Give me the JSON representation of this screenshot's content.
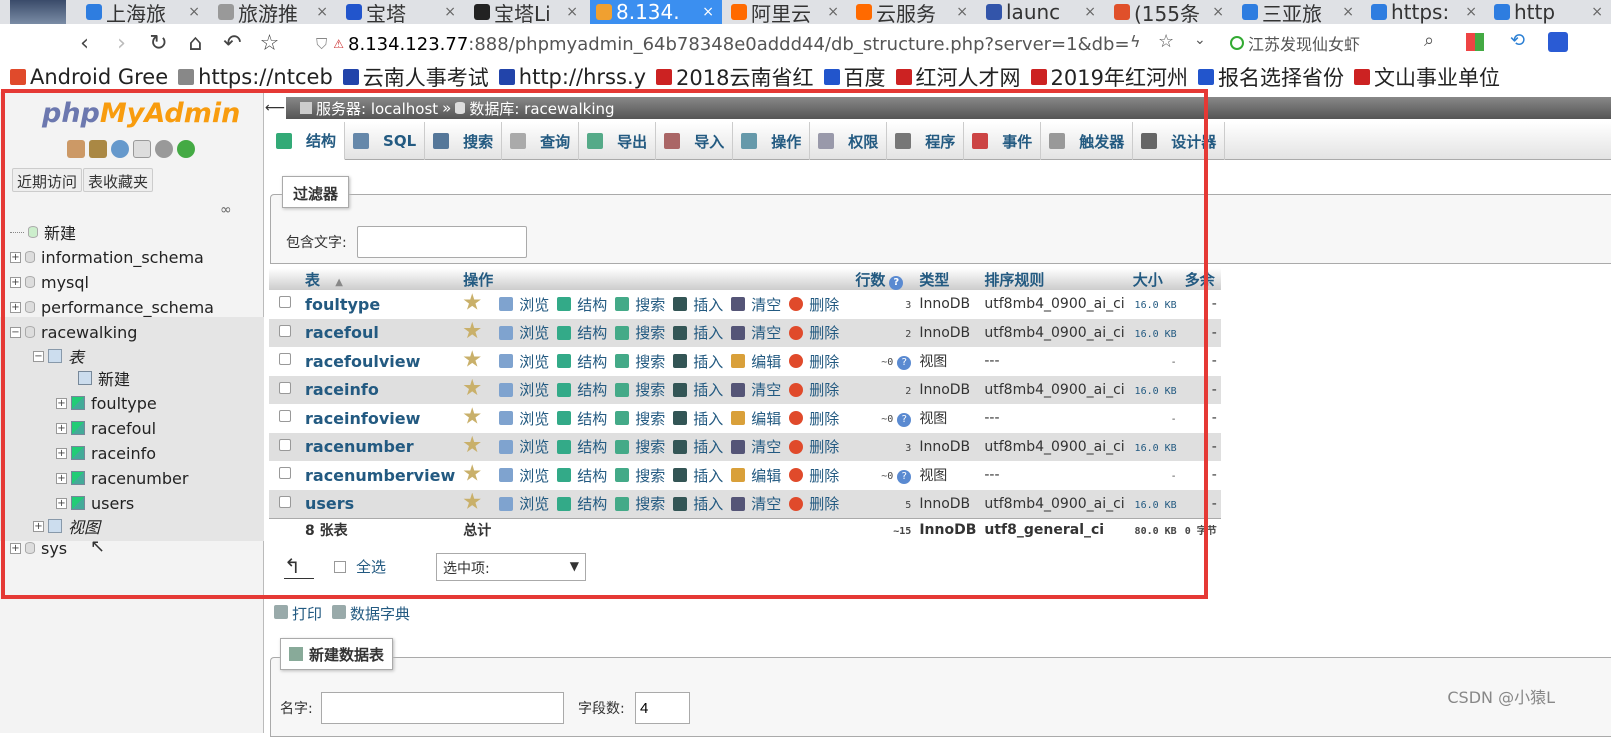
{
  "browser": {
    "tabs": [
      {
        "title": "上海旅",
        "color": "#2e7de0",
        "icon": "c"
      },
      {
        "title": "旅游推",
        "color": "#999999",
        "icon": "doc"
      },
      {
        "title": "宝塔_",
        "color": "#2255cc",
        "icon": "paw"
      },
      {
        "title": "宝塔Li",
        "color": "#222222",
        "icon": "BT"
      },
      {
        "title": "8.134.",
        "color": "#f0a030",
        "icon": "pma",
        "active": true
      },
      {
        "title": "阿里云",
        "color": "#ff6a00",
        "icon": "ali"
      },
      {
        "title": "云服务",
        "color": "#ff6a00",
        "icon": "ali"
      },
      {
        "title": "launc",
        "color": "#3355aa",
        "icon": "launch"
      },
      {
        "title": "(155条",
        "color": "#e0502a",
        "icon": "C"
      },
      {
        "title": "三亚旅",
        "color": "#2e7de0",
        "icon": "c"
      },
      {
        "title": "https:",
        "color": "#2e7de0",
        "icon": "c"
      },
      {
        "title": "http",
        "color": "#2e7de0",
        "icon": "c"
      }
    ],
    "close_glyph": "×",
    "url_prefix": "8.134.123.77",
    "url_rest": ":888/phpmyadmin_64b78348e0addd44/db_structure.php?server=1&db=",
    "search_hint": "江苏发现仙女虾",
    "bookmarks": [
      {
        "label": "Android Gree",
        "color": "#e04a2b"
      },
      {
        "label": "https://ntceb",
        "color": "#888888"
      },
      {
        "label": "云南人事考试",
        "color": "#2244aa"
      },
      {
        "label": "http://hrss.y",
        "color": "#2244aa"
      },
      {
        "label": "2018云南省红",
        "color": "#cc2222"
      },
      {
        "label": "百度",
        "color": "#2255cc"
      },
      {
        "label": "红河人才网",
        "color": "#cc2222"
      },
      {
        "label": "2019年红河州",
        "color": "#cc2222"
      },
      {
        "label": "报名选择省份",
        "color": "#2255cc"
      },
      {
        "label": "文山事业单位",
        "color": "#cc2222"
      }
    ]
  },
  "sidebar": {
    "logo_a": "php",
    "logo_b": "MyAdmin",
    "btn_recent": "近期访问",
    "btn_fav": "表收藏夹",
    "link_glyph": "∞",
    "tree": {
      "new": "新建",
      "dbs": [
        "information_schema",
        "mysql",
        "performance_schema",
        "racewalking",
        "sys"
      ],
      "tables_group": "表",
      "tables_new": "新建",
      "tables": [
        "foultype",
        "racefoul",
        "raceinfo",
        "racenumber",
        "users"
      ],
      "views_group": "视图"
    }
  },
  "main": {
    "breadcrumb_server": "服务器: localhost",
    "breadcrumb_sep": "»",
    "breadcrumb_db": "数据库: racewalking",
    "menu": [
      {
        "label": "结构",
        "color": "#3a7"
      },
      {
        "label": "SQL",
        "color": "#68a"
      },
      {
        "label": "搜索",
        "color": "#579"
      },
      {
        "label": "查询",
        "color": "#aaa"
      },
      {
        "label": "导出",
        "color": "#5a8"
      },
      {
        "label": "导入",
        "color": "#a66"
      },
      {
        "label": "操作",
        "color": "#69a"
      },
      {
        "label": "权限",
        "color": "#99a"
      },
      {
        "label": "程序",
        "color": "#777"
      },
      {
        "label": "事件",
        "color": "#c44"
      },
      {
        "label": "触发器",
        "color": "#999"
      },
      {
        "label": "设计器",
        "color": "#666"
      }
    ],
    "filter_legend": "过滤器",
    "filter_label": "包含文字:",
    "table": {
      "headers": {
        "table": "表",
        "sort": "▲",
        "actions": "操作",
        "rows": "行数",
        "type": "类型",
        "collation": "排序规则",
        "size": "大小",
        "overhead": "多余"
      },
      "action_labels": {
        "browse": "浏览",
        "structure": "结构",
        "search": "搜索",
        "insert": "插入",
        "empty": "清空",
        "edit": "编辑",
        "drop": "删除"
      },
      "rows": [
        {
          "name": "foultype",
          "rows": "3",
          "type": "InnoDB",
          "collation": "utf8mb4_0900_ai_ci",
          "size": "16.0 KB",
          "overhead": "-",
          "view": false
        },
        {
          "name": "racefoul",
          "rows": "2",
          "type": "InnoDB",
          "collation": "utf8mb4_0900_ai_ci",
          "size": "16.0 KB",
          "overhead": "-",
          "view": false
        },
        {
          "name": "racefoulview",
          "rows": "~0",
          "type": "视图",
          "collation": "---",
          "size": "-",
          "overhead": "-",
          "view": true
        },
        {
          "name": "raceinfo",
          "rows": "2",
          "type": "InnoDB",
          "collation": "utf8mb4_0900_ai_ci",
          "size": "16.0 KB",
          "overhead": "-",
          "view": false
        },
        {
          "name": "raceinfoview",
          "rows": "~0",
          "type": "视图",
          "collation": "---",
          "size": "-",
          "overhead": "-",
          "view": true
        },
        {
          "name": "racenumber",
          "rows": "3",
          "type": "InnoDB",
          "collation": "utf8mb4_0900_ai_ci",
          "size": "16.0 KB",
          "overhead": "-",
          "view": false
        },
        {
          "name": "racenumberview",
          "rows": "~0",
          "type": "视图",
          "collation": "---",
          "size": "-",
          "overhead": "-",
          "view": true
        },
        {
          "name": "users",
          "rows": "5",
          "type": "InnoDB",
          "collation": "utf8mb4_0900_ai_ci",
          "size": "16.0 KB",
          "overhead": "-",
          "view": false
        }
      ],
      "footer": {
        "count": "8 张表",
        "total": "总计",
        "rows": "~15",
        "type": "InnoDB",
        "collation": "utf8_general_ci",
        "size": "80.0 KB",
        "overhead": "0 字节"
      }
    },
    "select_all": "全选",
    "with_selected": "选中项:",
    "print": "打印",
    "data_dict": "数据字典",
    "new_table_legend": "新建数据表",
    "name_label": "名字:",
    "cols_label": "字段数:",
    "cols_value": "4"
  },
  "watermark": "CSDN @小猿L",
  "highlight_color": "#e53935"
}
